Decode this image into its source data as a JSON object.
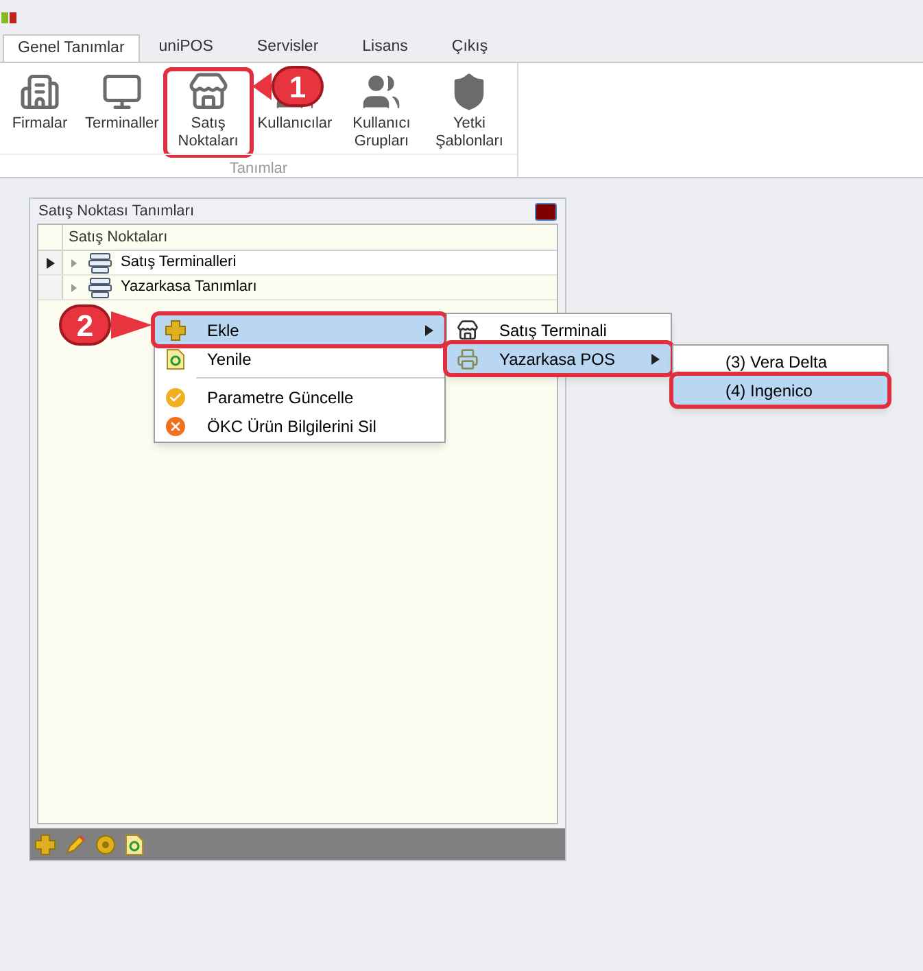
{
  "tabs": [
    {
      "label": "Genel Tanımlar",
      "selected": true
    },
    {
      "label": "uniPOS",
      "selected": false
    },
    {
      "label": "Servisler",
      "selected": false
    },
    {
      "label": "Lisans",
      "selected": false
    },
    {
      "label": "Çıkış",
      "selected": false
    }
  ],
  "ribbon": {
    "buttons": [
      {
        "label": "Firmalar",
        "highlighted": false
      },
      {
        "label": "Terminaller",
        "highlighted": false
      },
      {
        "label": "Satış Noktaları",
        "highlighted": true
      },
      {
        "label": "Kullanıcılar",
        "highlighted": false
      },
      {
        "label": "Kullanıcı Grupları",
        "highlighted": false
      },
      {
        "label": "Yetki Şablonları",
        "highlighted": false
      }
    ],
    "group_label": "Tanımlar"
  },
  "panel": {
    "title": "Satış Noktası Tanımları",
    "column": "Satış Noktaları",
    "rows": [
      {
        "label": "Satış Terminalleri",
        "current": true
      },
      {
        "label": "Yazarkasa Tanımları",
        "current": false
      }
    ]
  },
  "context_menu": [
    {
      "kind": "item",
      "label": "Ekle",
      "selected": true,
      "has_submenu": true
    },
    {
      "kind": "item",
      "label": "Yenile",
      "selected": false,
      "has_submenu": false
    },
    {
      "kind": "separator"
    },
    {
      "kind": "item",
      "label": "Parametre Güncelle",
      "selected": false,
      "has_submenu": false
    },
    {
      "kind": "item",
      "label": "ÖKC Ürün Bilgilerini Sil",
      "selected": false,
      "has_submenu": false
    }
  ],
  "submenu": [
    {
      "kind": "item",
      "label": "Satış Terminali",
      "selected": false,
      "has_submenu": false
    },
    {
      "kind": "item",
      "label": "Yazarkasa POS",
      "selected": true,
      "has_submenu": true
    }
  ],
  "submenu_2": [
    {
      "kind": "item",
      "label": "(3) Vera Delta",
      "selected": false,
      "has_submenu": false
    },
    {
      "kind": "item",
      "label": "(4) Ingenico",
      "selected": true,
      "has_submenu": false
    }
  ],
  "callouts": [
    "1",
    "2"
  ]
}
